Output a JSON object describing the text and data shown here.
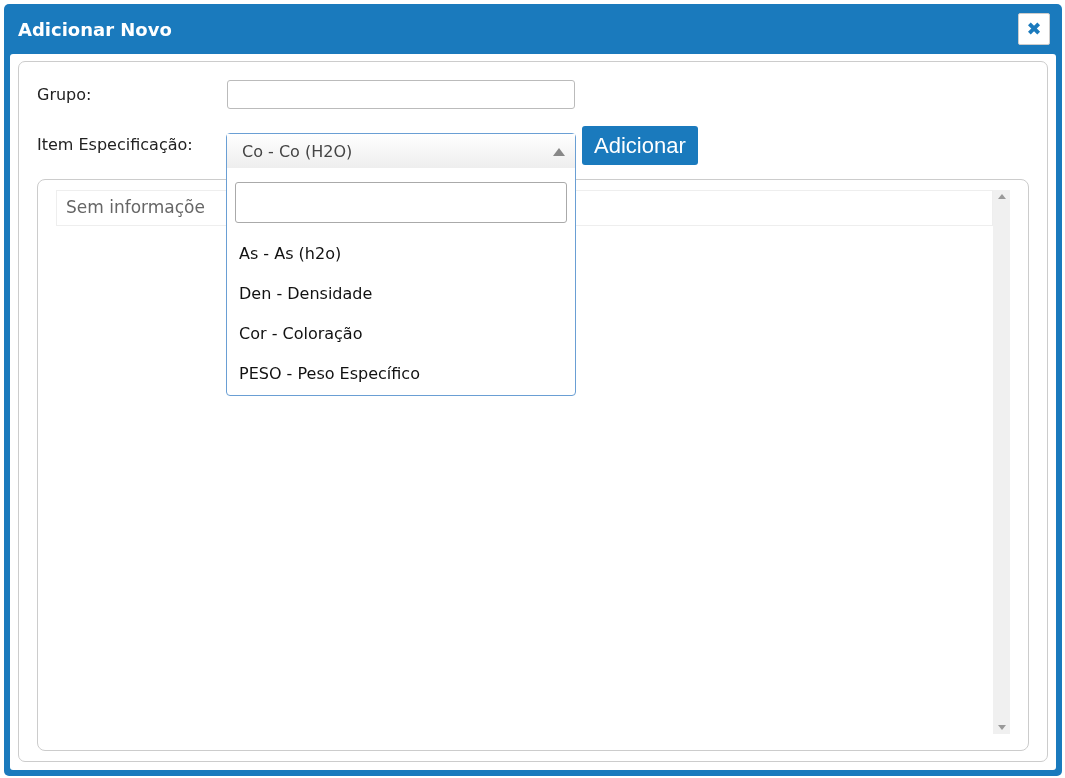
{
  "window": {
    "title": "Adicionar Novo",
    "close": "✖"
  },
  "form": {
    "grupo": {
      "label": "Grupo:"
    },
    "item": {
      "label": "Item Especificação:",
      "value": "Co - Co (H2O)",
      "expanded": true,
      "options": [
        {
          "label": "As - As (h2o)"
        },
        {
          "label": "Den - Densidade"
        },
        {
          "label": "Cor - Coloração"
        },
        {
          "label": "PESO - Peso Específico"
        }
      ]
    },
    "add_button": "Adicionar"
  },
  "table": {
    "empty_text": "Sem informaçõe"
  }
}
